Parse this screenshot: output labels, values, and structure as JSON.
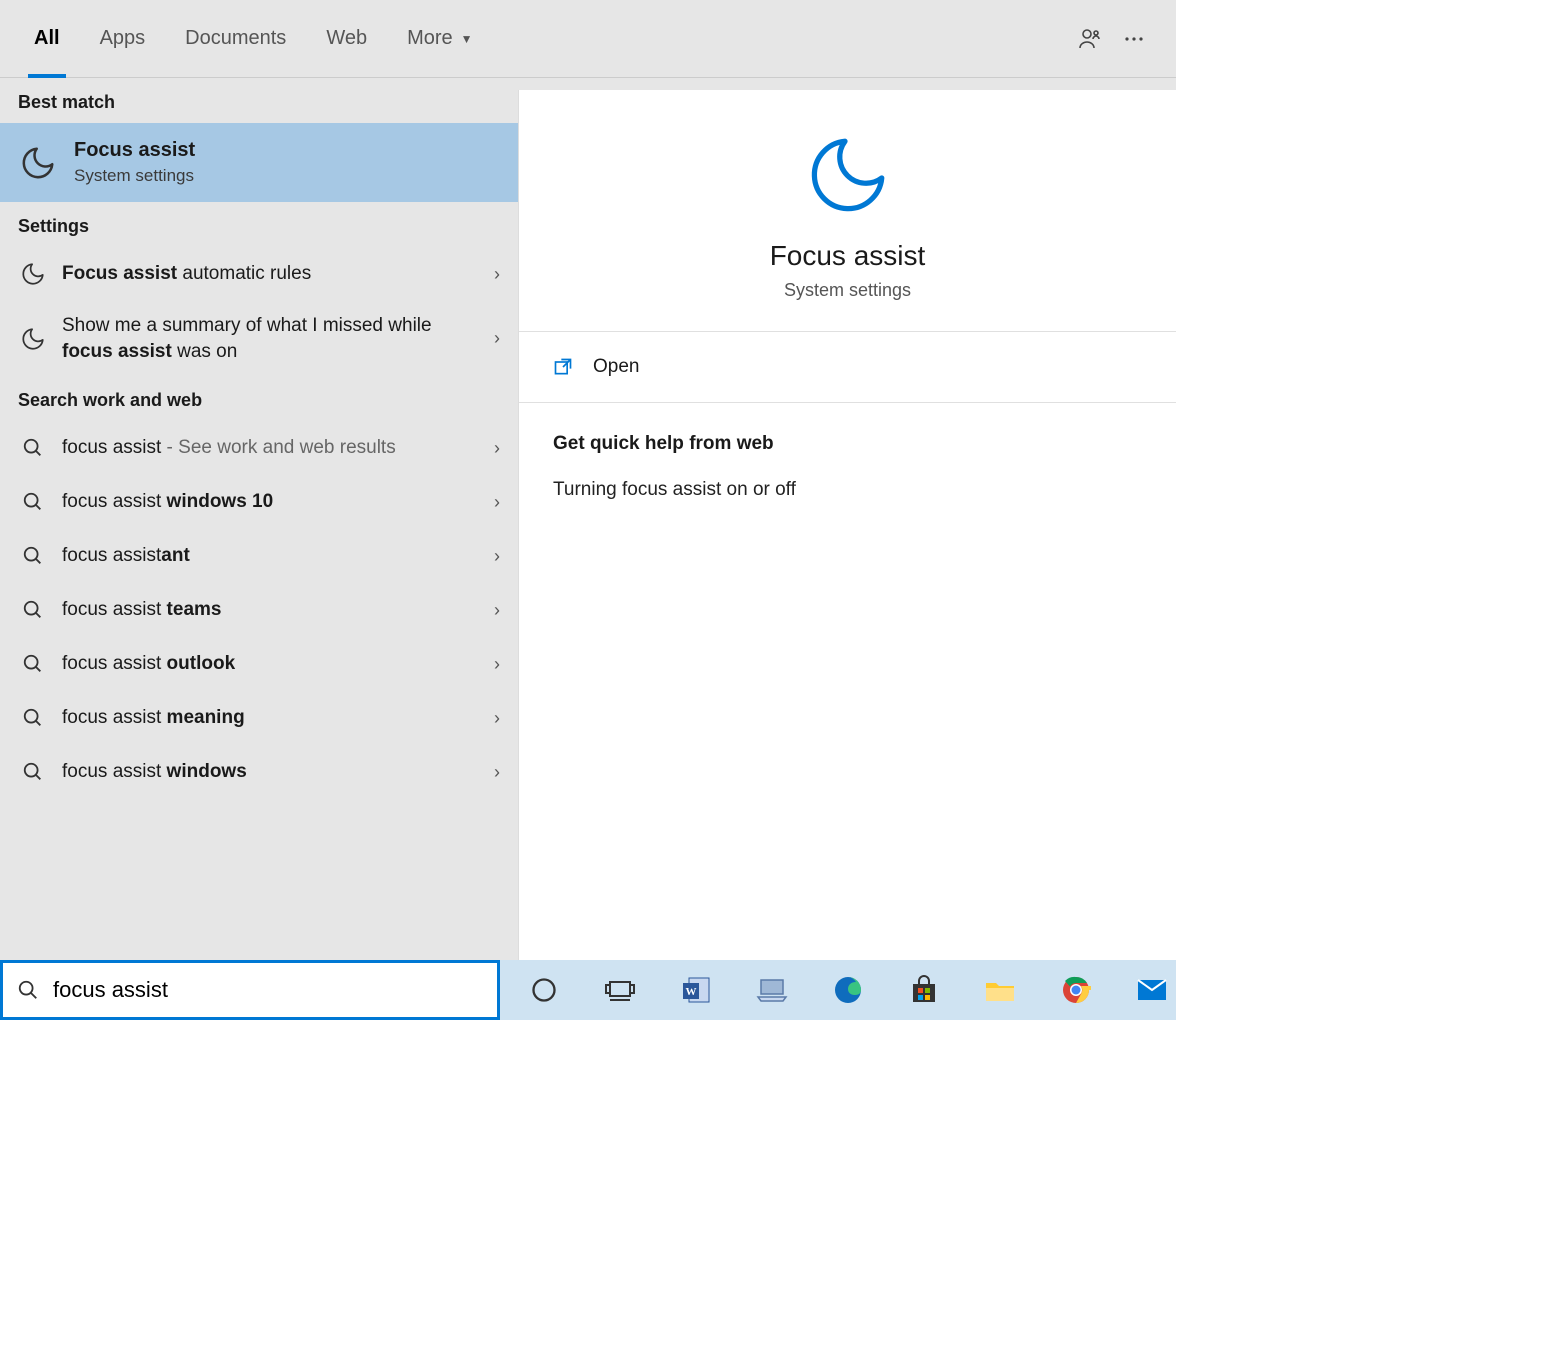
{
  "tabs": {
    "items": [
      "All",
      "Apps",
      "Documents",
      "Web",
      "More"
    ],
    "active_index": 0
  },
  "sections": {
    "best_match_header": "Best match",
    "settings_header": "Settings",
    "webwork_header": "Search work and web"
  },
  "best_match": {
    "title": "Focus assist",
    "subtitle": "System settings"
  },
  "settings_results": [
    {
      "prefix_bold": "Focus assist",
      "rest": " automatic rules"
    },
    {
      "plain_before": "Show me a summary of what I missed while ",
      "bold_mid": "focus assist",
      "plain_after": " was on"
    }
  ],
  "web_results": [
    {
      "pre": "focus assist",
      "bold": "",
      "suffix": " - See work and web results"
    },
    {
      "pre": "focus assist ",
      "bold": "windows 10",
      "suffix": ""
    },
    {
      "pre": "focus assist",
      "bold": "ant",
      "suffix": ""
    },
    {
      "pre": "focus assist ",
      "bold": "teams",
      "suffix": ""
    },
    {
      "pre": "focus assist ",
      "bold": "outlook",
      "suffix": ""
    },
    {
      "pre": "focus assist ",
      "bold": "meaning",
      "suffix": ""
    },
    {
      "pre": "focus assist ",
      "bold": "windows",
      "suffix": ""
    }
  ],
  "preview": {
    "title": "Focus assist",
    "subtitle": "System settings",
    "open_label": "Open",
    "help_header": "Get quick help from web",
    "help_links": [
      "Turning focus assist on or off"
    ]
  },
  "search_box": {
    "value": "focus assist"
  },
  "taskbar": {
    "items": [
      "cortana",
      "task-view",
      "word",
      "laptop",
      "edge",
      "store",
      "explorer",
      "chrome",
      "mail"
    ]
  }
}
